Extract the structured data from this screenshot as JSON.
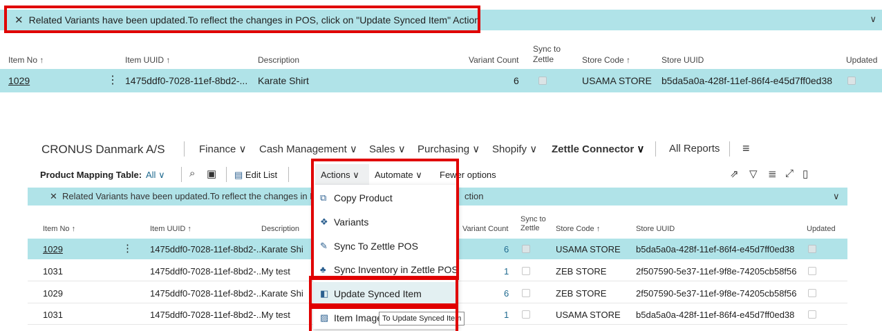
{
  "zoom": {
    "banner_text": "Related Variants have been updated.To reflect the changes in POS, click on \"Update Synced Item\" Action",
    "columns": [
      "Item No ↑",
      "Item UUID ↑",
      "Description",
      "Variant Count",
      "Sync to Zettle",
      "Store Code ↑",
      "Store UUID",
      "Updated"
    ],
    "row": {
      "item_no": "1029",
      "item_uuid": "1475ddf0-7028-11ef-8bd2-...",
      "description": "Karate Shirt",
      "variant_count": "6",
      "store_code": "USAMA STORE",
      "store_uuid": "b5da5a0a-428f-11ef-86f4-e45d7ff0ed38"
    }
  },
  "nav": {
    "company": "CRONUS Danmark A/S",
    "items": [
      "Finance",
      "Cash Management",
      "Sales",
      "Purchasing",
      "Shopify",
      "Zettle Connector",
      "All Reports"
    ]
  },
  "actionbar": {
    "title": "Product Mapping Table:",
    "filter": "All",
    "edit_list": "Edit List",
    "actions": "Actions",
    "automate": "Automate",
    "fewer": "Fewer options"
  },
  "banner2": {
    "left": "Related Variants have been updated.To reflect the changes in POS",
    "right": "ction"
  },
  "columns2": [
    "Item No ↑",
    "Item UUID ↑",
    "Description",
    "Variant Count",
    "Sync to Zettle",
    "Store Code ↑",
    "Store UUID",
    "Updated"
  ],
  "rows": [
    {
      "item_no": "1029",
      "item_uuid": "1475ddf0-7028-11ef-8bd2-...",
      "description": "Karate Shi",
      "variant_count": "6",
      "store_code": "USAMA STORE",
      "store_uuid": "b5da5a0a-428f-11ef-86f4-e45d7ff0ed38"
    },
    {
      "item_no": "1031",
      "item_uuid": "1475ddf0-7028-11ef-8bd2-...",
      "description": "My test",
      "variant_count": "1",
      "store_code": "ZEB STORE",
      "store_uuid": "2f507590-5e37-11ef-9f8e-74205cb58f56"
    },
    {
      "item_no": "1029",
      "item_uuid": "1475ddf0-7028-11ef-8bd2-...",
      "description": "Karate Shi",
      "variant_count": "6",
      "store_code": "ZEB STORE",
      "store_uuid": "2f507590-5e37-11ef-9f8e-74205cb58f56"
    },
    {
      "item_no": "1031",
      "item_uuid": "1475ddf0-7028-11ef-8bd2-...",
      "description": "My test",
      "variant_count": "1",
      "store_code": "USAMA STORE",
      "store_uuid": "b5da5a0a-428f-11ef-86f4-e45d7ff0ed38"
    }
  ],
  "menu": {
    "items": [
      "Copy Product",
      "Variants",
      "Sync To Zettle POS",
      "Sync Inventory in Zettle POS",
      "Update Synced Item",
      "Item Image"
    ],
    "tooltip": "To Update Synced Item"
  },
  "colors": {
    "highlight": "#b0e3e8",
    "annotation": "#e00000"
  }
}
